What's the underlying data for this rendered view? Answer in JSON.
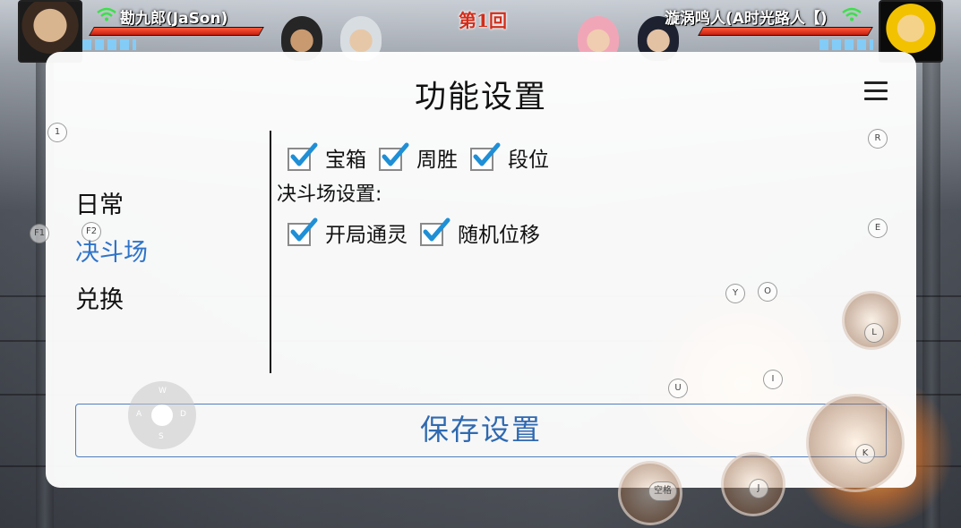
{
  "hud": {
    "left_player": "勘九郎(JaSon)",
    "right_player": "漩涡鸣人(A时光路人【)",
    "round": "第1回"
  },
  "panel": {
    "title": "功能设置",
    "nav": [
      "日常",
      "决斗场",
      "兑换"
    ],
    "active_nav": "决斗场",
    "options_row1": [
      {
        "label": "宝箱",
        "checked": true
      },
      {
        "label": "周胜",
        "checked": true
      },
      {
        "label": "段位",
        "checked": true
      }
    ],
    "section_label": "决斗场设置:",
    "options_row2": [
      {
        "label": "开局通灵",
        "checked": true
      },
      {
        "label": "随机位移",
        "checked": true
      }
    ],
    "save_label": "保存设置"
  },
  "overlay_keys": [
    "1",
    "F1",
    "F2",
    "R",
    "E",
    "Y",
    "O",
    "L",
    "U",
    "I",
    "K",
    "J",
    "空格"
  ],
  "dpad": {
    "up": "W",
    "left": "A",
    "right": "D",
    "down": "S"
  },
  "colors": {
    "accent": "#2f74c9",
    "check": "#1f8fd6",
    "hp_bar": "#e23b22"
  }
}
